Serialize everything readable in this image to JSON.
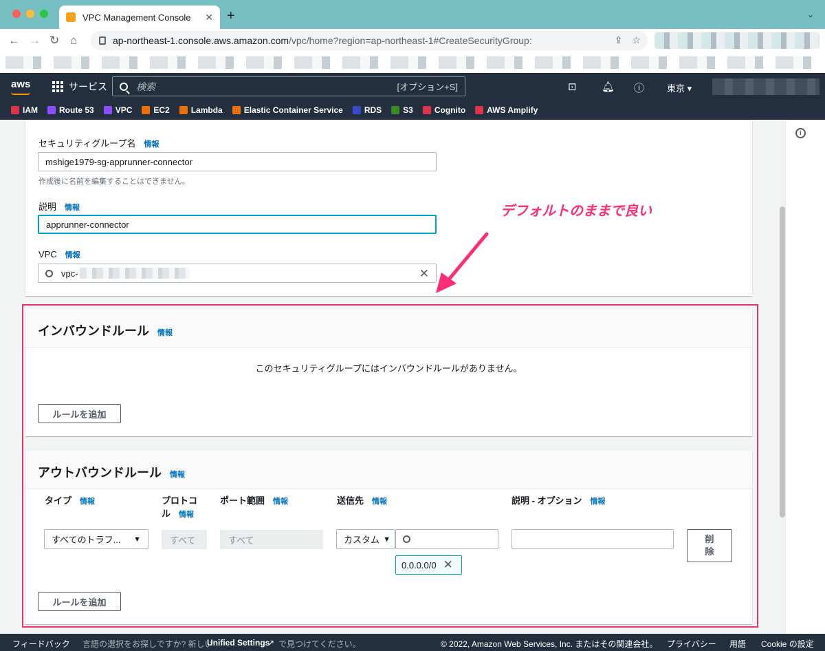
{
  "browser": {
    "tab_title": "VPC Management Console",
    "url_host": "ap-northeast-1.console.aws.amazon.com",
    "url_path": "/vpc/home?region=ap-northeast-1#CreateSecurityGroup:"
  },
  "aws_header": {
    "logo": "aws",
    "services": "サービス",
    "search_placeholder": "検索",
    "search_shortcut": "[オプション+S]",
    "region": "東京 ▾"
  },
  "favorites": [
    {
      "label": "IAM",
      "color": "#dd344c"
    },
    {
      "label": "Route 53",
      "color": "#8c4fff"
    },
    {
      "label": "VPC",
      "color": "#8c4fff"
    },
    {
      "label": "EC2",
      "color": "#ed7100"
    },
    {
      "label": "Lambda",
      "color": "#ed7100"
    },
    {
      "label": "Elastic Container Service",
      "color": "#ed7100"
    },
    {
      "label": "RDS",
      "color": "#3b48cc"
    },
    {
      "label": "S3",
      "color": "#3f8624"
    },
    {
      "label": "Cognito",
      "color": "#dd344c"
    },
    {
      "label": "AWS Amplify",
      "color": "#dd344c"
    }
  ],
  "basic": {
    "name_label": "セキュリティグループ名",
    "info": "情報",
    "name_value": "mshige1979-sg-apprunner-connector",
    "name_hint": "作成後に名前を編集することはできません。",
    "desc_label": "説明",
    "desc_value": "apprunner-connector",
    "vpc_label": "VPC",
    "vpc_value": "vpc-"
  },
  "annotation": "デフォルトのままで良い",
  "inbound": {
    "title": "インバウンドルール",
    "info": "情報",
    "empty": "このセキュリティグループにはインバウンドルールがありません。",
    "add_button": "ルールを追加"
  },
  "outbound": {
    "title": "アウトバウンドルール",
    "info": "情報",
    "columns": {
      "type": "タイプ",
      "protocol_1": "プロトコ",
      "protocol_2": "ル",
      "port": "ポート範囲",
      "dest": "送信先",
      "desc": "説明 - オプション"
    },
    "row": {
      "type_value": "すべてのトラフ...",
      "protocol_value": "すべて",
      "port_value": "すべて",
      "dest_select": "カスタム",
      "token": "0.0.0.0/0",
      "delete_1": "削",
      "delete_2": "除"
    },
    "add_button": "ルールを追加"
  },
  "footer": {
    "feedback": "フィードバック",
    "lang_prompt": "言語の選択をお探しですか? 新しい",
    "unified": "Unified Settings",
    "lang_suffix": "で見つけてください。",
    "copyright": "© 2022, Amazon Web Services, Inc. またはその関連会社。",
    "privacy": "プライバシー",
    "terms": "用語",
    "cookie": "Cookie の設定"
  }
}
